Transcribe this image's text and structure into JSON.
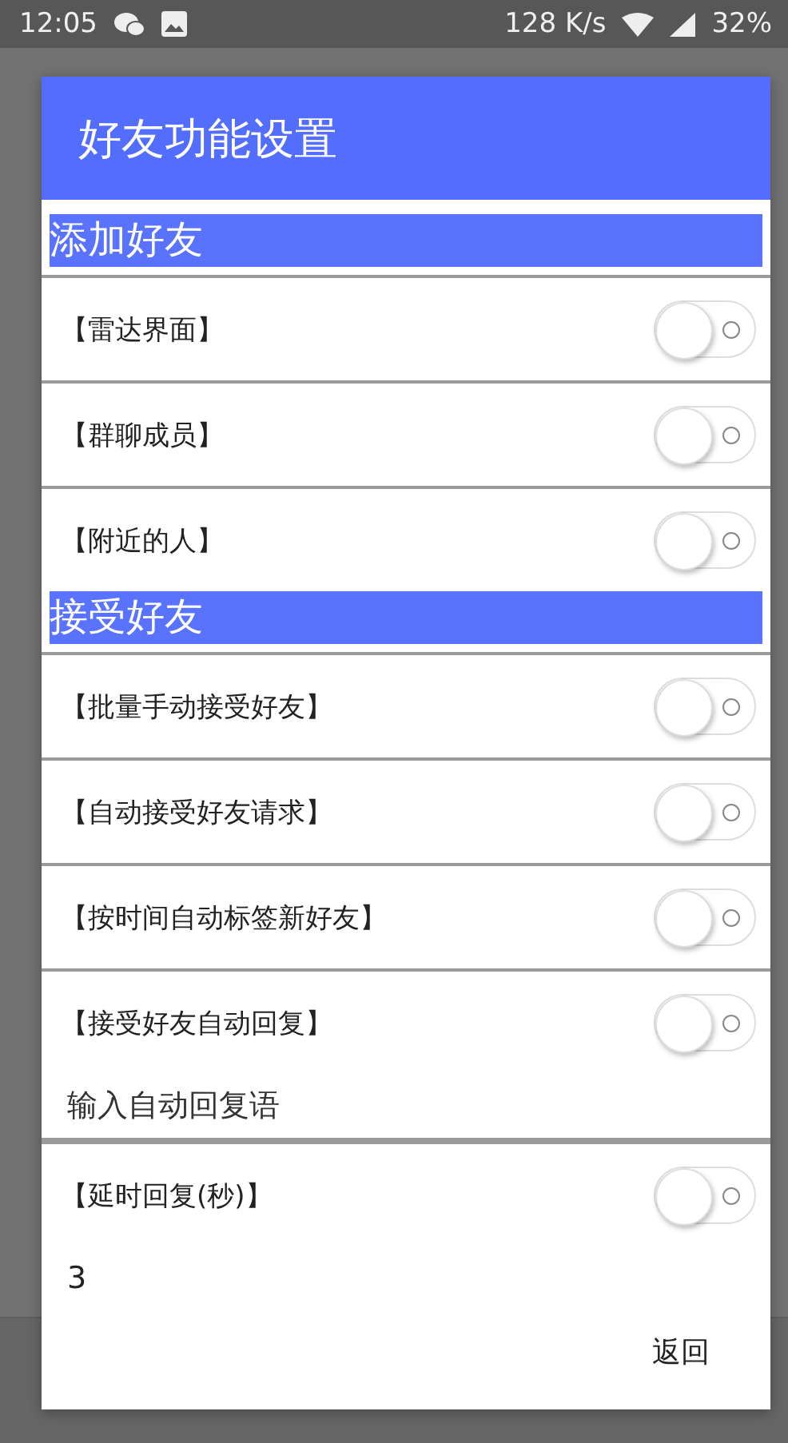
{
  "status_bar": {
    "time": "12:05",
    "speed": "128 K/s",
    "battery": "32%"
  },
  "dialog": {
    "title": "好友功能设置",
    "sections": [
      {
        "title": "添加好友",
        "items": [
          {
            "kind": "toggle",
            "label": "【雷达界面】",
            "on": false
          },
          {
            "kind": "toggle",
            "label": "【群聊成员】",
            "on": false
          },
          {
            "kind": "toggle",
            "label": "【附近的人】",
            "on": false
          }
        ]
      },
      {
        "title": "接受好友",
        "items": [
          {
            "kind": "toggle",
            "label": "【批量手动接受好友】",
            "on": false
          },
          {
            "kind": "toggle",
            "label": "【自动接受好友请求】",
            "on": false
          },
          {
            "kind": "toggle",
            "label": "【按时间自动标签新好友】",
            "on": false
          },
          {
            "kind": "toggle",
            "label": "【接受好友自动回复】",
            "on": false
          },
          {
            "kind": "field",
            "placeholder": "输入自动回复语"
          },
          {
            "kind": "toggle",
            "label": "【延时回复(秒)】",
            "on": false
          },
          {
            "kind": "field",
            "value": "3"
          }
        ]
      }
    ],
    "button": "返回"
  }
}
